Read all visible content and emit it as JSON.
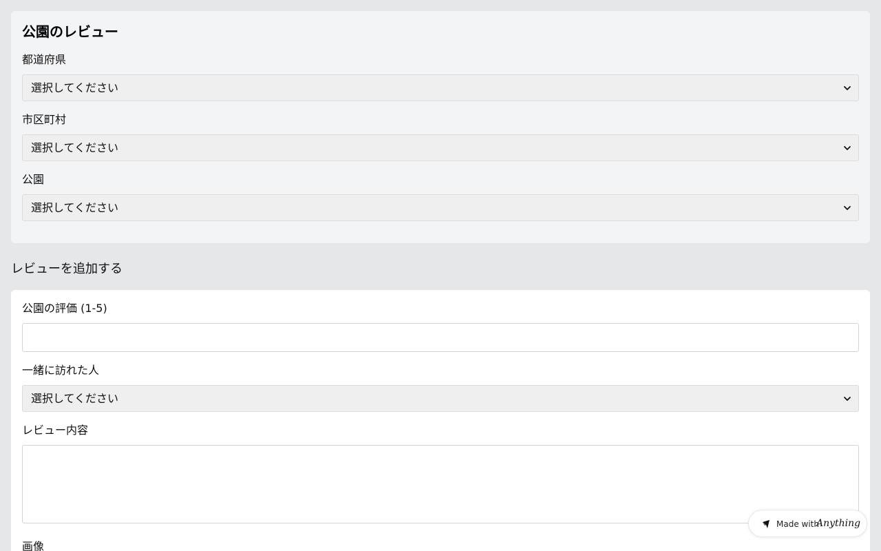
{
  "park_review": {
    "title": "公園のレビュー",
    "prefecture": {
      "label": "都道府県",
      "selected": "選択してください"
    },
    "city": {
      "label": "市区町村",
      "selected": "選択してください"
    },
    "park": {
      "label": "公園",
      "selected": "選択してください"
    }
  },
  "add_review": {
    "section_title": "レビューを追加する",
    "rating": {
      "label": "公園の評価 (1-5)",
      "value": ""
    },
    "companion": {
      "label": "一緒に訪れた人",
      "selected": "選択してください"
    },
    "content": {
      "label": "レビュー内容",
      "value": ""
    },
    "image": {
      "label": "画像"
    }
  },
  "badge": {
    "made_with": "Made with",
    "brand": "Anything"
  },
  "colors": {
    "page_bg": "#e5e7eb",
    "card_top_bg": "#f3f4f6",
    "card_bottom_bg": "#ffffff",
    "select_bg": "#efefef"
  },
  "icons": {
    "select_chevron": "chevron-down-icon",
    "badge_logo": "anything-logo-icon"
  }
}
